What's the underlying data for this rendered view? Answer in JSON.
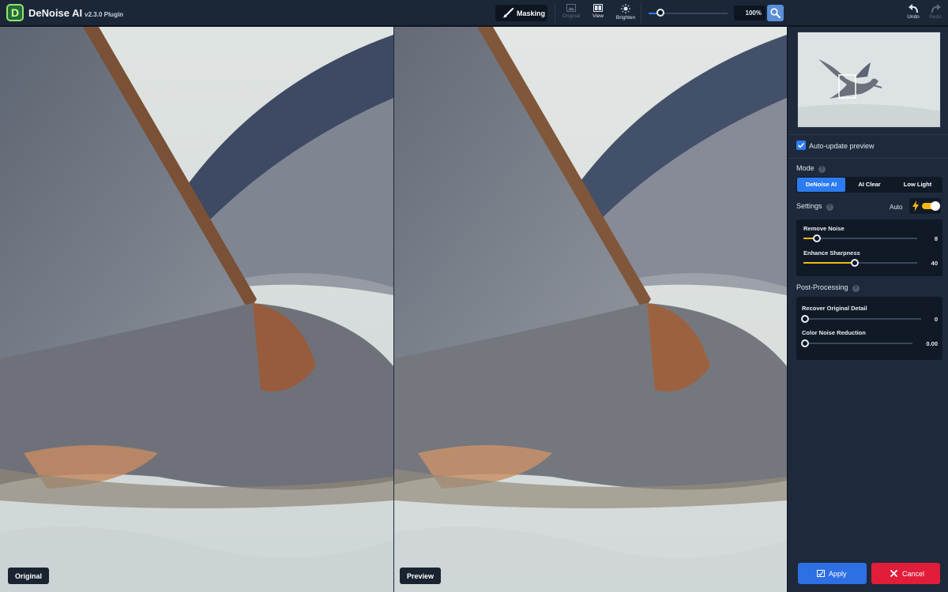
{
  "app": {
    "name": "DeNoise AI",
    "version": "v2.3.0 Plugin",
    "logo_letter": "D"
  },
  "toolbar": {
    "masking_label": "Masking",
    "original_label": "Original",
    "view_label": "View",
    "brighten_label": "Brighten",
    "zoom_level": 0.15,
    "zoom_value": "100%",
    "undo_label": "Undo",
    "redo_label": "Redo"
  },
  "panes": {
    "left_label": "Original",
    "right_label": "Preview"
  },
  "panel": {
    "auto_update_label": "Auto-update preview",
    "auto_update_checked": true,
    "mode": {
      "title": "Mode",
      "options": [
        "DeNoise AI",
        "AI Clear",
        "Low Light"
      ],
      "active": "DeNoise AI"
    },
    "settings": {
      "title": "Settings",
      "auto_label": "Auto",
      "auto_on": true,
      "sliders": [
        {
          "label": "Remove Noise",
          "value": "8",
          "fraction": 0.12
        },
        {
          "label": "Enhance Sharpness",
          "value": "40",
          "fraction": 0.45
        }
      ]
    },
    "post": {
      "title": "Post-Processing",
      "sliders": [
        {
          "label": "Recover Original Detail",
          "value": "0",
          "fraction": 0.0
        },
        {
          "label": "Color Noise Reduction",
          "value": "0.00",
          "fraction": 0.0
        }
      ]
    },
    "apply_label": "Apply",
    "cancel_label": "Cancel"
  },
  "colors": {
    "accent": "#2d7bf0",
    "slider_fill": "#f4b814",
    "apply": "#2f6fe4",
    "cancel": "#e11d3a",
    "panel_bg": "#1e2a3b"
  }
}
